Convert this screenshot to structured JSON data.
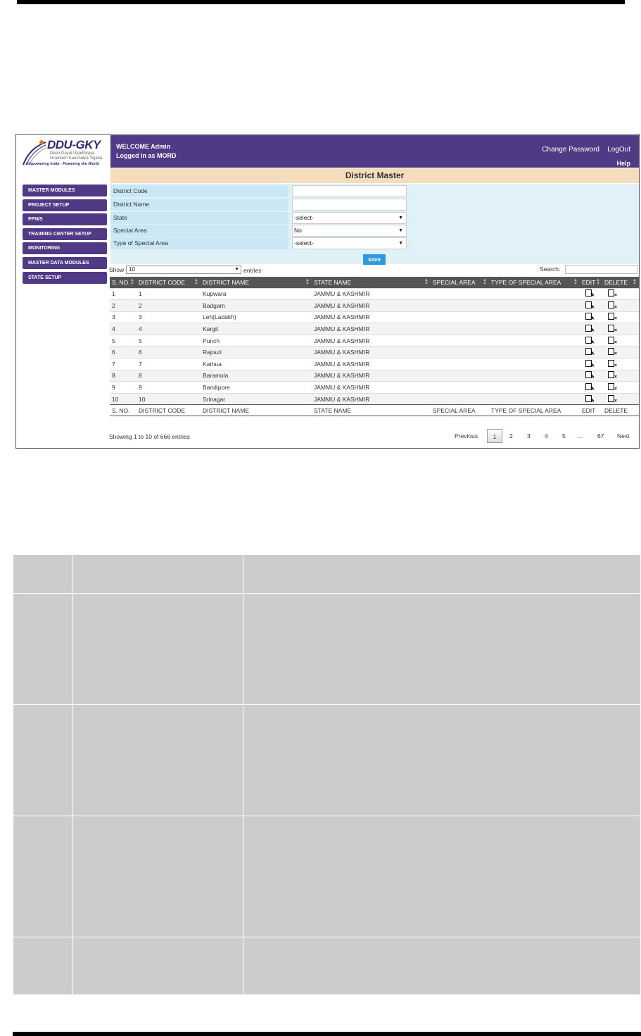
{
  "header": {
    "brand": "DDU-GKY",
    "brand_sub1": "Deen Dayal Upadhyaya",
    "brand_sub2": "Grameen Kaushalya Yojana",
    "tagline": "Empowering India - Powering the World",
    "welcome": "WELCOME  Admin",
    "logged_in": "Logged in as  MORD",
    "change_password": "Change Password",
    "logout": "LogOut",
    "help": "Help"
  },
  "page_title": "District Master",
  "sidebar": {
    "items": [
      {
        "label": "MASTER MODULES"
      },
      {
        "label": "PROJECT SETUP"
      },
      {
        "label": "PPWS"
      },
      {
        "label": "TRAINING CENTER SETUP"
      },
      {
        "label": "MONITORING"
      },
      {
        "label": "MASTER DATA MODULES"
      },
      {
        "label": "STATE SETUP"
      }
    ]
  },
  "form": {
    "district_code_label": "District Code",
    "district_code_value": "",
    "district_name_label": "District Name",
    "district_name_value": "",
    "state_label": "State",
    "state_value": "-select-",
    "special_area_label": "Special Area",
    "special_area_value": "No",
    "type_special_area_label": "Type of Special Area",
    "type_special_area_value": "-select-",
    "save_label": "save"
  },
  "table_controls": {
    "show_label": "Show",
    "show_value": "10",
    "entries_label": "entries",
    "search_label": "Search:",
    "search_value": ""
  },
  "table": {
    "columns": [
      "S. NO.",
      "DISTRICT CODE",
      "DISTRICT NAME",
      "STATE NAME",
      "SPECIAL AREA",
      "TYPE OF SPECIAL AREA",
      "EDIT",
      "DELETE"
    ],
    "rows": [
      {
        "sno": "1",
        "code": "1",
        "name": "Kupwara",
        "state": "JAMMU & KASHMIR",
        "special": "",
        "type": ""
      },
      {
        "sno": "2",
        "code": "2",
        "name": "Badgam",
        "state": "JAMMU & KASHMIR",
        "special": "",
        "type": ""
      },
      {
        "sno": "3",
        "code": "3",
        "name": "Leh(Ladakh)",
        "state": "JAMMU & KASHMIR",
        "special": "",
        "type": ""
      },
      {
        "sno": "4",
        "code": "4",
        "name": "Kargil",
        "state": "JAMMU & KASHMIR",
        "special": "",
        "type": ""
      },
      {
        "sno": "5",
        "code": "5",
        "name": "Punch",
        "state": "JAMMU & KASHMIR",
        "special": "",
        "type": ""
      },
      {
        "sno": "6",
        "code": "6",
        "name": "Rajouri",
        "state": "JAMMU & KASHMIR",
        "special": "",
        "type": ""
      },
      {
        "sno": "7",
        "code": "7",
        "name": "Kathua",
        "state": "JAMMU & KASHMIR",
        "special": "",
        "type": ""
      },
      {
        "sno": "8",
        "code": "8",
        "name": "Baramula",
        "state": "JAMMU & KASHMIR",
        "special": "",
        "type": ""
      },
      {
        "sno": "9",
        "code": "9",
        "name": "Bandipore",
        "state": "JAMMU & KASHMIR",
        "special": "",
        "type": ""
      },
      {
        "sno": "10",
        "code": "10",
        "name": "Srinagar",
        "state": "JAMMU & KASHMIR",
        "special": "",
        "type": ""
      }
    ]
  },
  "footer": {
    "info": "Showing 1 to 10 of 666 entries",
    "previous": "Previous",
    "pages": [
      "1",
      "2",
      "3",
      "4",
      "5",
      "…",
      "67"
    ],
    "next": "Next"
  },
  "colors": {
    "header_purple": "#503a85",
    "title_beige": "#f5dcbc",
    "form_blue": "#e1f1f8",
    "save_blue": "#3399dd",
    "table_header": "#555555",
    "grid_gray": "#cccccc"
  },
  "icons": {
    "edit": "edit-doc-icon",
    "delete": "delete-doc-icon",
    "logo": "ddu-gky-swoosh-logo"
  }
}
